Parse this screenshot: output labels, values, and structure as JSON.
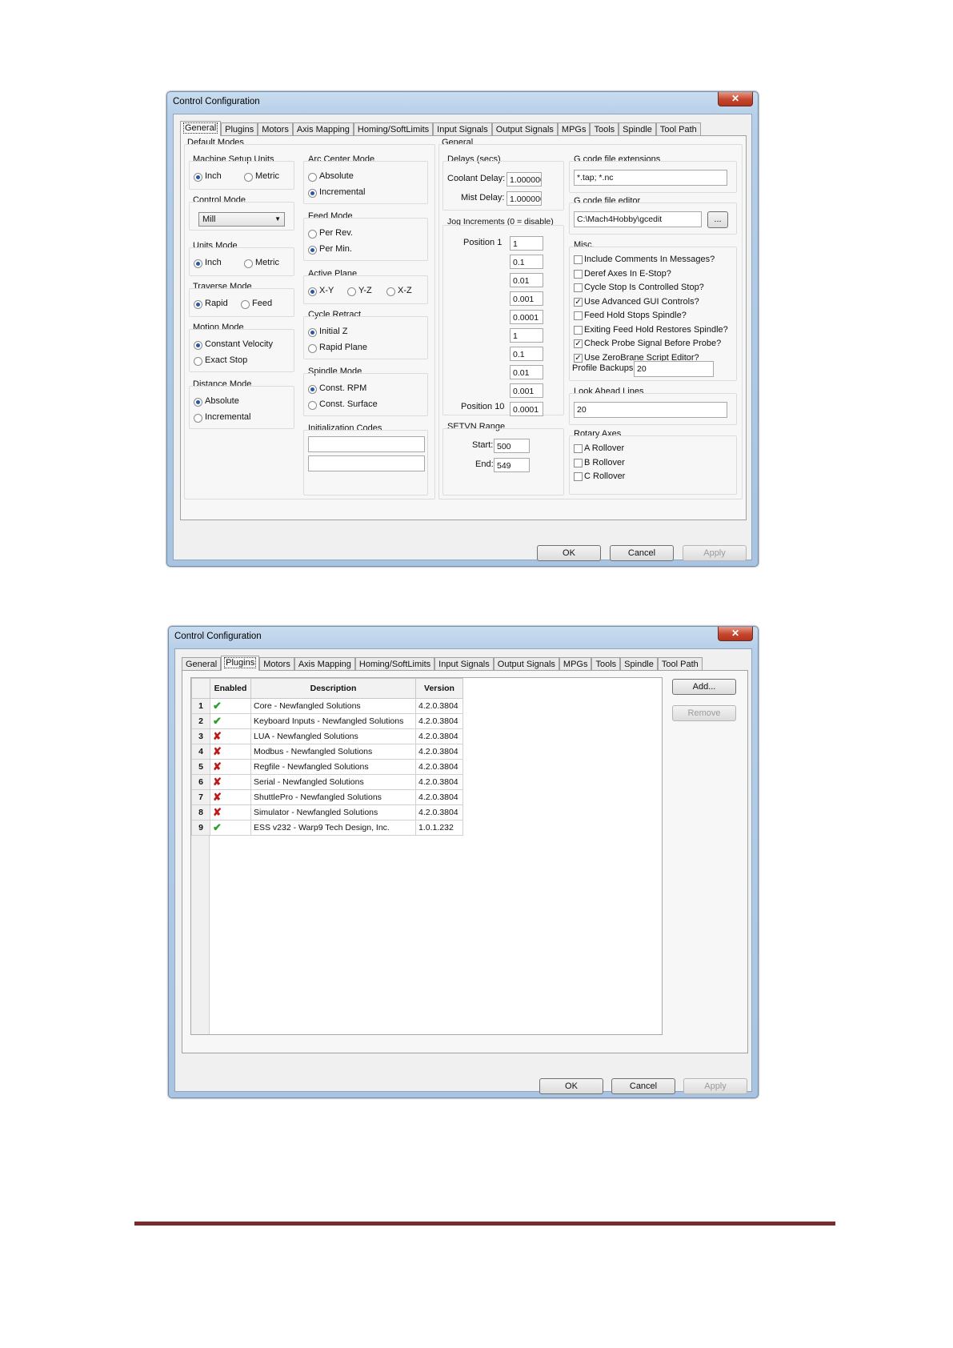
{
  "window1": {
    "title": "Control Configuration",
    "close": "✕",
    "tabs": [
      "General",
      "Plugins",
      "Motors",
      "Axis Mapping",
      "Homing/SoftLimits",
      "Input Signals",
      "Output Signals",
      "MPGs",
      "Tools",
      "Spindle",
      "Tool Path"
    ],
    "default_modes": {
      "title": "Default Modes",
      "machine_setup_units": {
        "title": "Machine Setup Units",
        "opt1": "Inch",
        "opt2": "Metric"
      },
      "control_mode": {
        "title": "Control Mode",
        "value": "Mill"
      },
      "units_mode": {
        "title": "Units Mode",
        "opt1": "Inch",
        "opt2": "Metric"
      },
      "traverse_mode": {
        "title": "Traverse Mode",
        "opt1": "Rapid",
        "opt2": "Feed"
      },
      "motion_mode": {
        "title": "Motion Mode",
        "opt1": "Constant Velocity",
        "opt2": "Exact Stop"
      },
      "distance_mode": {
        "title": "Distance Mode",
        "opt1": "Absolute",
        "opt2": "Incremental"
      },
      "arc_center_mode": {
        "title": "Arc Center Mode",
        "opt1": "Absolute",
        "opt2": "Incremental"
      },
      "feed_mode": {
        "title": "Feed Mode",
        "opt1": "Per Rev.",
        "opt2": "Per Min."
      },
      "active_plane": {
        "title": "Active Plane",
        "opt1": "X-Y",
        "opt2": "Y-Z",
        "opt3": "X-Z"
      },
      "cycle_retract": {
        "title": "Cycle Retract",
        "opt1": "Initial Z",
        "opt2": "Rapid Plane"
      },
      "spindle_mode": {
        "title": "Spindle Mode",
        "opt1": "Const. RPM",
        "opt2": "Const. Surface"
      },
      "init_codes": {
        "title": "Initialization Codes"
      }
    },
    "general": {
      "title": "General",
      "delays": {
        "title": "Delays (secs)",
        "coolant_label": "Coolant Delay:",
        "coolant_value": "1.000000",
        "mist_label": "Mist Delay:",
        "mist_value": "1.000000"
      },
      "jog": {
        "title": "Jog Increments (0 = disable)",
        "pos1_label": "Position 1",
        "pos10_label": "Position 10",
        "values": [
          "1",
          "0.1",
          "0.01",
          "0.001",
          "0.0001",
          "1",
          "0.1",
          "0.01",
          "0.001",
          "0.0001"
        ]
      },
      "setvn": {
        "title": "SETVN Range",
        "start_label": "Start:",
        "start_value": "500",
        "end_label": "End:",
        "end_value": "549"
      },
      "gcode_ext": {
        "title": "G code file extensions",
        "value": "*.tap; *.nc"
      },
      "gcode_editor": {
        "title": "G code file editor",
        "value": "C:\\Mach4Hobby\\gcedit",
        "browse": "..."
      },
      "misc": {
        "title": "Misc.",
        "items": [
          {
            "label": "Include Comments In Messages?",
            "checked": false
          },
          {
            "label": "Deref Axes In E-Stop?",
            "checked": false
          },
          {
            "label": "Cycle Stop Is Controlled Stop?",
            "checked": false
          },
          {
            "label": "Use Advanced GUI Controls?",
            "checked": true
          },
          {
            "label": "Feed Hold Stops Spindle?",
            "checked": false
          },
          {
            "label": "Exiting Feed Hold Restores Spindle?",
            "checked": false
          },
          {
            "label": "Check Probe Signal Before Probe?",
            "checked": true
          },
          {
            "label": "Use ZeroBrane Script Editor?",
            "checked": true
          }
        ],
        "profile_backups_label": "Profile Backups:",
        "profile_backups_value": "20"
      },
      "look_ahead": {
        "title": "Look Ahead Lines",
        "value": "20"
      },
      "rotary": {
        "title": "Rotary Axes",
        "items": [
          "A Rollover",
          "B Rollover",
          "C Rollover"
        ]
      }
    },
    "buttons": {
      "ok": "OK",
      "cancel": "Cancel",
      "apply": "Apply"
    }
  },
  "window2": {
    "title": "Control Configuration",
    "close": "✕",
    "tabs": [
      "General",
      "Plugins",
      "Motors",
      "Axis Mapping",
      "Homing/SoftLimits",
      "Input Signals",
      "Output Signals",
      "MPGs",
      "Tools",
      "Spindle",
      "Tool Path"
    ],
    "columns": [
      "Enabled",
      "Description",
      "Version"
    ],
    "rows": [
      {
        "n": "1",
        "enabled": true,
        "desc": "Core - Newfangled Solutions",
        "ver": "4.2.0.3804"
      },
      {
        "n": "2",
        "enabled": true,
        "desc": "Keyboard Inputs - Newfangled Solutions",
        "ver": "4.2.0.3804"
      },
      {
        "n": "3",
        "enabled": false,
        "desc": "LUA - Newfangled Solutions",
        "ver": "4.2.0.3804"
      },
      {
        "n": "4",
        "enabled": false,
        "desc": "Modbus - Newfangled Solutions",
        "ver": "4.2.0.3804"
      },
      {
        "n": "5",
        "enabled": false,
        "desc": "Regfile - Newfangled Solutions",
        "ver": "4.2.0.3804"
      },
      {
        "n": "6",
        "enabled": false,
        "desc": "Serial - Newfangled Solutions",
        "ver": "4.2.0.3804"
      },
      {
        "n": "7",
        "enabled": false,
        "desc": "ShuttlePro - Newfangled Solutions",
        "ver": "4.2.0.3804"
      },
      {
        "n": "8",
        "enabled": false,
        "desc": "Simulator - Newfangled Solutions",
        "ver": "4.2.0.3804"
      },
      {
        "n": "9",
        "enabled": true,
        "desc": "ESS v232 - Warp9 Tech Design, Inc.",
        "ver": "1.0.1.232"
      }
    ],
    "side_buttons": {
      "add": "Add...",
      "remove": "Remove"
    },
    "buttons": {
      "ok": "OK",
      "cancel": "Cancel",
      "apply": "Apply"
    }
  },
  "colors": {
    "rule": "#7a2c2c",
    "enabled": "#2aa02a",
    "disabled": "#c01818"
  },
  "icons": {
    "enabled": "checkmark-icon",
    "disabled": "x-mark-icon"
  }
}
